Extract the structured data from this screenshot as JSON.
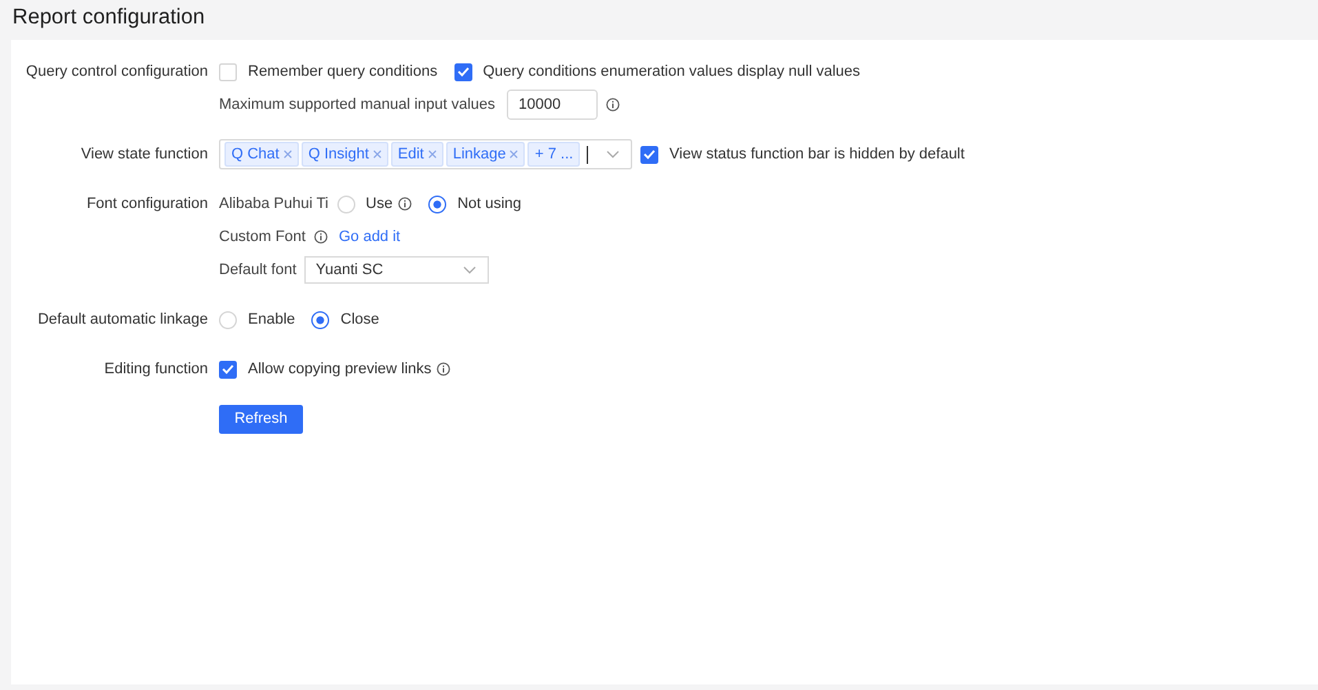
{
  "page": {
    "title": "Report configuration"
  },
  "sections": [
    {
      "label": "Query control configuration",
      "lines": [
        [
          {
            "kind": "checkbox",
            "label": "Remember query conditions",
            "checked": false
          },
          {
            "kind": "checkbox",
            "label": "Query conditions enumeration values display null values",
            "checked": true
          }
        ],
        [
          {
            "kind": "text",
            "text": "Maximum supported manual input values"
          },
          {
            "kind": "input",
            "value": "10000"
          },
          {
            "kind": "info"
          }
        ]
      ]
    },
    {
      "label": "View state function",
      "lines": [
        [
          {
            "kind": "tags",
            "tags": [
              "Q Chat",
              "Q Insight",
              "Edit",
              "Linkage"
            ],
            "more": "+ 7 ..."
          },
          {
            "kind": "checkbox",
            "label": "View status function bar is hidden by default",
            "checked": true
          }
        ]
      ]
    },
    {
      "label": "Font configuration",
      "lines": [
        [
          {
            "kind": "text",
            "text": "Alibaba Puhui Ti"
          },
          {
            "kind": "radio",
            "label": "Use",
            "selected": false
          },
          {
            "kind": "info"
          },
          {
            "kind": "radio",
            "label": "Not using",
            "selected": true
          }
        ],
        [
          {
            "kind": "text",
            "text": "Custom Font"
          },
          {
            "kind": "info"
          },
          {
            "kind": "link",
            "text": "Go add it"
          }
        ],
        [
          {
            "kind": "text",
            "text": "Default font"
          },
          {
            "kind": "select",
            "value": "Yuanti SC"
          }
        ]
      ]
    },
    {
      "label": "Default automatic linkage",
      "lines": [
        [
          {
            "kind": "radio",
            "label": "Enable",
            "selected": false
          },
          {
            "kind": "radio",
            "label": "Close",
            "selected": true
          }
        ]
      ]
    },
    {
      "label": "Editing function",
      "lines": [
        [
          {
            "kind": "checkbox",
            "label": "Allow copying preview links",
            "checked": true
          },
          {
            "kind": "info"
          }
        ]
      ]
    },
    {
      "lines": [
        [
          {
            "kind": "button",
            "label": "Refresh"
          }
        ]
      ]
    }
  ]
}
